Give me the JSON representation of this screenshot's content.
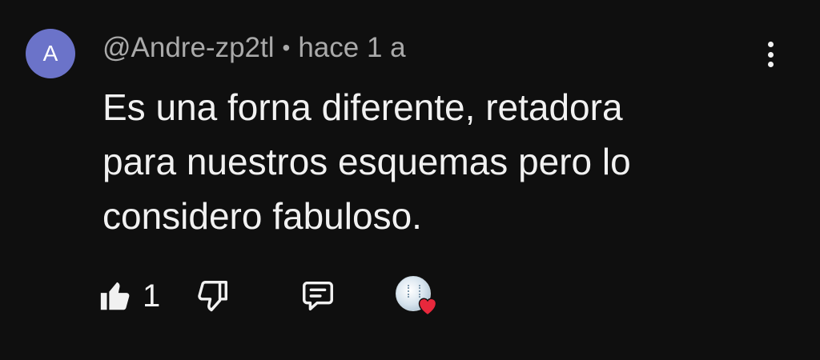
{
  "comment": {
    "avatar_letter": "A",
    "author": "@Andre-zp2tl",
    "separator": "•",
    "time": "hace 1 a",
    "text": "Es una forna diferente, retadora\npara nuestros esquemas pero lo\nconsidero fabuloso.",
    "like_count": "1"
  },
  "icons": {
    "more": "more-vert-icon",
    "like": "thumb-up-filled-icon",
    "dislike": "thumb-down-icon",
    "reply": "comment-icon",
    "creator_heart": "heart-icon"
  },
  "colors": {
    "background": "#0f0f0f",
    "avatar": "#6b73c9",
    "meta_text": "#aaaaaa",
    "text": "#f1f1f1",
    "heart": "#e8283c"
  }
}
